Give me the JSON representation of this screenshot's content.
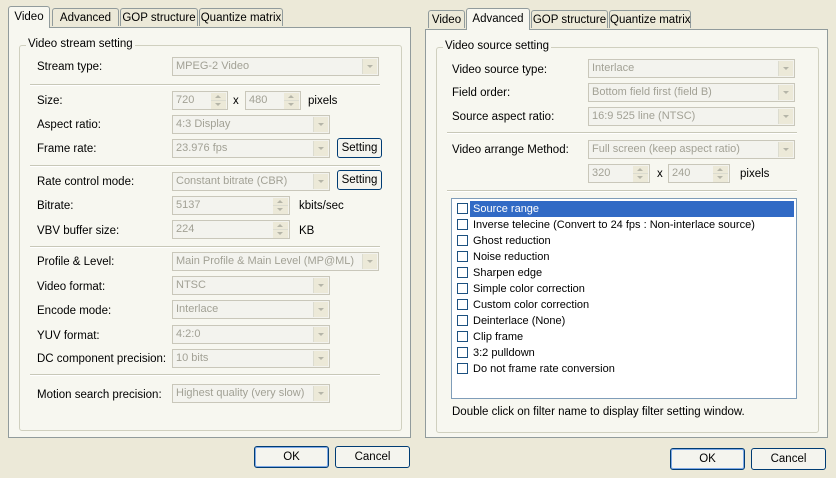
{
  "left": {
    "tabs": [
      "Video",
      "Advanced",
      "GOP structure",
      "Quantize matrix"
    ],
    "active_tab": "Video",
    "group_title": "Video stream setting",
    "stream_type": {
      "label": "Stream type:",
      "value": "MPEG-2 Video"
    },
    "size": {
      "label": "Size:",
      "width": "720",
      "x": "x",
      "height": "480",
      "unit": "pixels"
    },
    "aspect_ratio": {
      "label": "Aspect ratio:",
      "value": "4:3 Display"
    },
    "frame_rate": {
      "label": "Frame rate:",
      "value": "23.976 fps",
      "button": "Setting"
    },
    "rate_control": {
      "label": "Rate control mode:",
      "value": "Constant bitrate (CBR)",
      "button": "Setting"
    },
    "bitrate": {
      "label": "Bitrate:",
      "value": "5137",
      "unit": "kbits/sec"
    },
    "vbv": {
      "label": "VBV buffer size:",
      "value": "224",
      "unit": "KB"
    },
    "profile": {
      "label": "Profile & Level:",
      "value": "Main Profile & Main Level (MP@ML)"
    },
    "video_format": {
      "label": "Video format:",
      "value": "NTSC"
    },
    "encode_mode": {
      "label": "Encode mode:",
      "value": "Interlace"
    },
    "yuv": {
      "label": "YUV format:",
      "value": "4:2:0"
    },
    "dc": {
      "label": "DC component precision:",
      "value": "10 bits"
    },
    "motion": {
      "label": "Motion search precision:",
      "value": "Highest quality (very slow)"
    },
    "ok": "OK",
    "cancel": "Cancel"
  },
  "right": {
    "tabs": [
      "Video",
      "Advanced",
      "GOP structure",
      "Quantize matrix"
    ],
    "active_tab": "Advanced",
    "group_title": "Video source setting",
    "source_type": {
      "label": "Video source type:",
      "value": "Interlace"
    },
    "field_order": {
      "label": "Field order:",
      "value": "Bottom field first (field B)"
    },
    "aspect": {
      "label": "Source aspect ratio:",
      "value": "16:9 525 line (NTSC)"
    },
    "arrange": {
      "label": "Video arrange Method:",
      "value": "Full screen (keep aspect ratio)"
    },
    "arr_size": {
      "width": "320",
      "x": "x",
      "height": "240",
      "unit": "pixels"
    },
    "filters": [
      "Source range",
      "Inverse telecine (Convert to 24 fps : Non-interlace source)",
      "Ghost reduction",
      "Noise reduction",
      "Sharpen edge",
      "Simple color correction",
      "Custom color correction",
      "Deinterlace (None)",
      "Clip frame",
      "3:2 pulldown",
      "Do not frame rate conversion"
    ],
    "selected_filter": "Source range",
    "hint": "Double click on filter name to display filter setting window.",
    "ok": "OK",
    "cancel": "Cancel"
  },
  "colors": {
    "dialog_bg": "#ece9d8",
    "panel_bg": "#f7f7f0",
    "selection": "#316ac5",
    "disabled_text": "#a2a195"
  }
}
